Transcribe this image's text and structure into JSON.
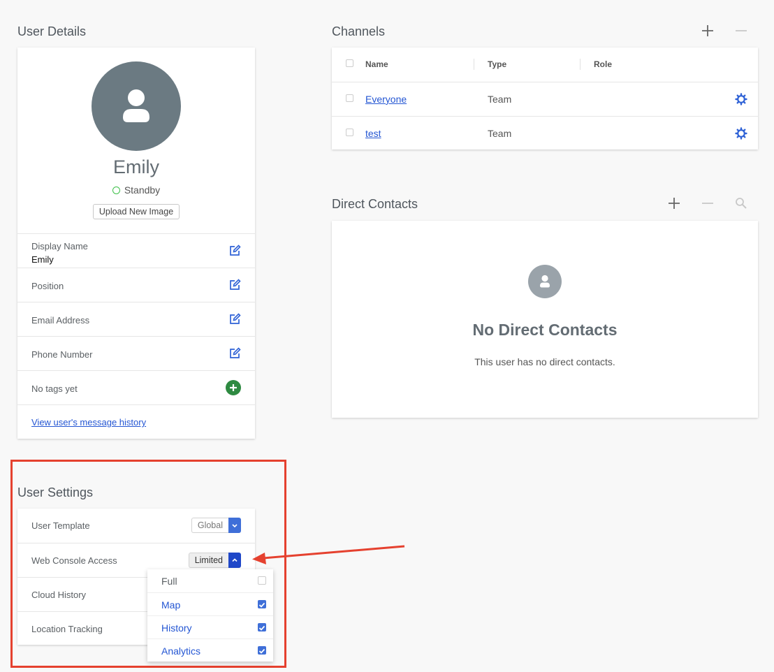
{
  "user_details": {
    "title": "User Details",
    "name": "Emily",
    "status": "Standby",
    "upload_label": "Upload New Image",
    "fields": [
      {
        "label": "Display Name",
        "value": "Emily"
      },
      {
        "label": "Position",
        "value": ""
      },
      {
        "label": "Email Address",
        "value": ""
      },
      {
        "label": "Phone Number",
        "value": ""
      }
    ],
    "tags_label": "No tags yet",
    "history_link": "View user's message history"
  },
  "channels": {
    "title": "Channels",
    "columns": [
      "Name",
      "Type",
      "Role"
    ],
    "rows": [
      {
        "name": "Everyone",
        "type": "Team",
        "role": ""
      },
      {
        "name": "test",
        "type": "Team",
        "role": ""
      }
    ]
  },
  "direct_contacts": {
    "title": "Direct Contacts",
    "empty_title": "No Direct Contacts",
    "empty_text": "This user has no direct contacts."
  },
  "user_settings": {
    "title": "User Settings",
    "rows": [
      {
        "label": "User Template",
        "value": "Global"
      },
      {
        "label": "Web Console Access",
        "value": "Limited"
      },
      {
        "label": "Cloud History",
        "value": ""
      },
      {
        "label": "Location Tracking",
        "value": ""
      }
    ],
    "dropdown_options": [
      {
        "label": "Full",
        "checked": false
      },
      {
        "label": "Map",
        "checked": true
      },
      {
        "label": "History",
        "checked": true
      },
      {
        "label": "Analytics",
        "checked": true
      }
    ]
  },
  "colors": {
    "accent": "#3f6fd8",
    "link": "#2456d3",
    "status": "#3ec04a",
    "add_tag": "#2e8a41",
    "highlight": "#e5412f"
  },
  "icons": {
    "plus": "plus-icon",
    "minus": "minus-icon",
    "search": "search-icon",
    "edit": "edit-icon",
    "gear": "gear-icon"
  }
}
